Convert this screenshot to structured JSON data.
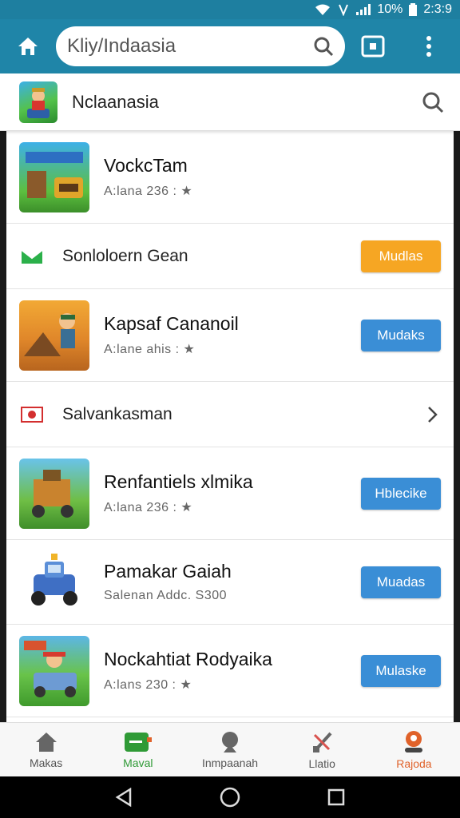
{
  "status": {
    "battery": "10%",
    "time": "2:3:9"
  },
  "toolbar": {
    "search_value": "Kliy/Indaasia"
  },
  "header": {
    "title": "Nclaanasia"
  },
  "list": {
    "item1": {
      "name": "VockcTam",
      "meta": "A:lana 236 : ★"
    },
    "section1": {
      "label": "Sonloloern Gean",
      "button": "Mudlas"
    },
    "item2": {
      "name": "Kapsaf Cananoil",
      "meta": "A:lane ahis : ★",
      "button": "Mudaks"
    },
    "section2": {
      "label": "Salvankasman"
    },
    "item3": {
      "name": "Renfantiels xlmika",
      "meta": "A:lana 236 : ★",
      "button": "Hblecike"
    },
    "item4": {
      "name": "Pamakar Gaiah",
      "meta": "Salenan Addc. S300",
      "button": "Muadas"
    },
    "item5": {
      "name": "Nockahtiat Rodyaika",
      "meta": "A:lans 230 : ★",
      "button": "Mulaske"
    }
  },
  "bottom_nav": [
    {
      "label": "Makas",
      "color": "#555555"
    },
    {
      "label": "Maval",
      "color": "#2f9a36"
    },
    {
      "label": "Inmpaanah",
      "color": "#555555"
    },
    {
      "label": "Llatio",
      "color": "#555555"
    },
    {
      "label": "Rajoda",
      "color": "#e0622a"
    }
  ],
  "colors": {
    "toolbar": "#1f85a8",
    "blue_button": "#3a8ed6",
    "orange_button": "#f6a623"
  }
}
